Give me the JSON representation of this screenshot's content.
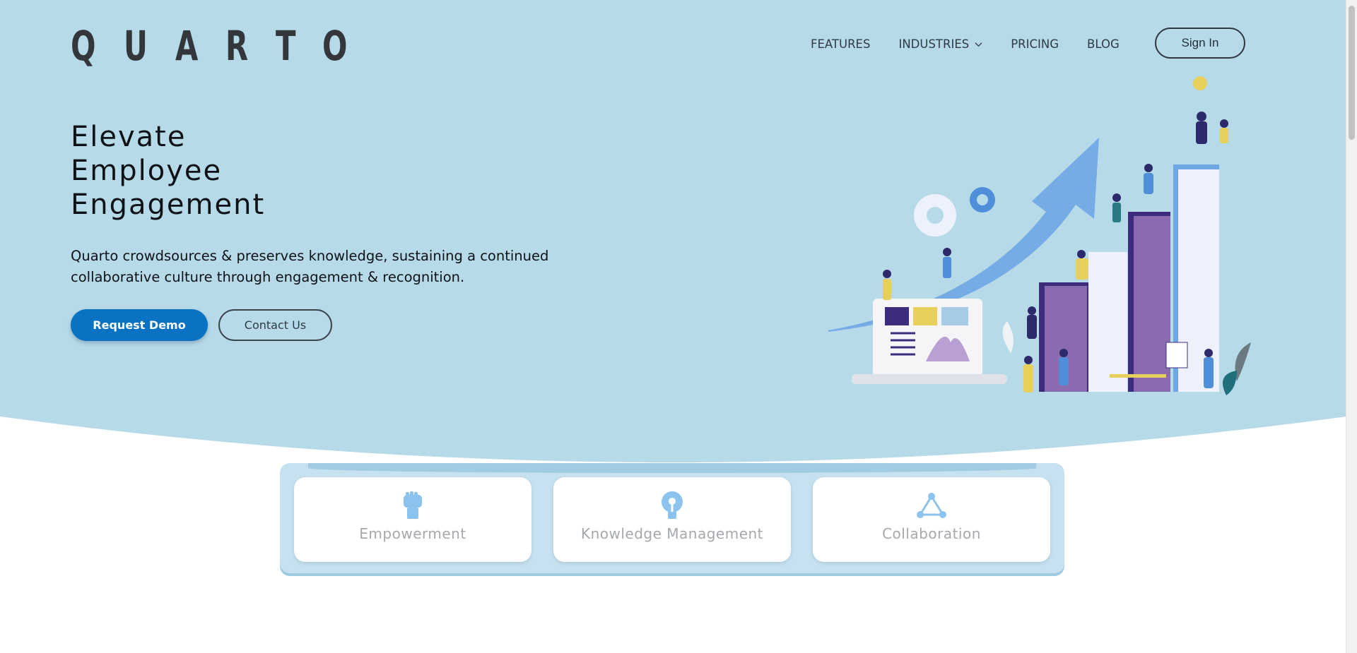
{
  "brand": {
    "logo_letters": [
      "Q",
      "U",
      "A",
      "R",
      "T",
      "O"
    ]
  },
  "nav": {
    "items": [
      {
        "label": "FEATURES"
      },
      {
        "label": "INDUSTRIES"
      },
      {
        "label": "PRICING"
      },
      {
        "label": "BLOG"
      }
    ],
    "sign_in": "Sign In"
  },
  "hero": {
    "headline": [
      "Elevate",
      "Employee",
      "Engagement"
    ],
    "subtitle": "Quarto crowdsources & preserves knowledge, sustaining a continued collaborative culture through engagement & recognition.",
    "primary_cta": "Request Demo",
    "secondary_cta": "Contact Us"
  },
  "features": [
    {
      "label": "Empowerment",
      "icon": "fist-icon"
    },
    {
      "label": "Knowledge Management",
      "icon": "lightbulb-icon"
    },
    {
      "label": "Collaboration",
      "icon": "triangle-network-icon"
    }
  ],
  "colors": {
    "hero_bg": "#b7dae8",
    "primary": "#0a72c2",
    "icon_blue": "#8cc3ee"
  }
}
